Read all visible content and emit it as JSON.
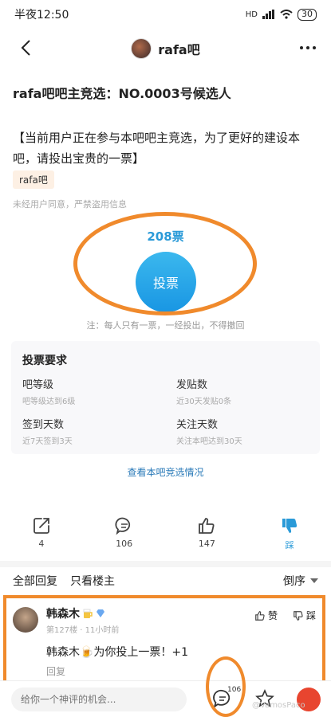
{
  "status_bar": {
    "time": "半夜12:50",
    "network": "HD",
    "battery": "30"
  },
  "nav": {
    "title": "rafa吧"
  },
  "post": {
    "title": "rafa吧吧主竞选：NO.0003号候选人",
    "body": "【当前用户正在参与本吧吧主竞选，为了更好的建设本吧，请投出宝贵的一票】",
    "tag": "rafa吧",
    "copyright_note": "未经用户同意，严禁盗用信息"
  },
  "vote": {
    "count_label": "208票",
    "button_label": "投票",
    "note": "注：每人只有一票，一经投出，不得撤回"
  },
  "requirements": {
    "title": "投票要求",
    "items": [
      {
        "name": "吧等级",
        "desc": "吧等级达到6级"
      },
      {
        "name": "发贴数",
        "desc": "近30天发贴0条"
      },
      {
        "name": "签到天数",
        "desc": "近7天签到3天"
      },
      {
        "name": "关注天数",
        "desc": "关注本吧达到30天"
      }
    ]
  },
  "view_link": "查看本吧竞选情况",
  "actions": [
    {
      "icon": "share-icon",
      "count": "4"
    },
    {
      "icon": "comment-icon",
      "count": "106"
    },
    {
      "icon": "thumbs-up-icon",
      "count": "147"
    },
    {
      "icon": "thumbs-down-icon",
      "label": "踩"
    }
  ],
  "reply_tabs": {
    "all": "全部回复",
    "owner_only": "只看楼主",
    "sort": "倒序"
  },
  "comment": {
    "author": "韩森木",
    "floor": "第127楼",
    "time": "11小时前",
    "text": "韩森木🍺为你投上一票！+1",
    "reply_label": "回复",
    "like_label": "赞",
    "dislike_label": "踩"
  },
  "bottom_bar": {
    "input_placeholder": "给你一个神评的机会...",
    "comment_count": "106"
  },
  "watermark": "@VamosPaco",
  "colors": {
    "accent_blue": "#2a9ad8",
    "highlight_orange": "#f08a2c",
    "share_red": "#e8452f"
  }
}
